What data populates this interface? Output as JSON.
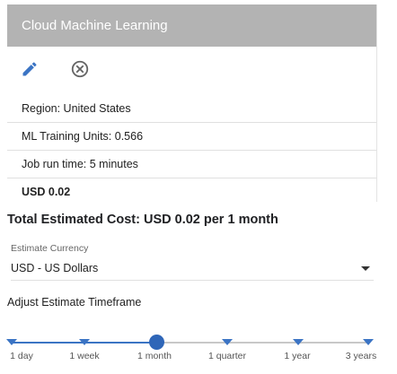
{
  "card": {
    "title": "Cloud Machine Learning",
    "edit_icon": "pencil-icon",
    "remove_icon": "close-circle-icon",
    "rows": [
      "Region: United States",
      "ML Training Units: 0.566",
      "Job run time: 5 minutes",
      "USD 0.02"
    ]
  },
  "total": {
    "text": "Total Estimated Cost: USD 0.02 per 1 month"
  },
  "currency": {
    "label": "Estimate Currency",
    "selected": "USD - US Dollars"
  },
  "timeframe": {
    "title": "Adjust Estimate Timeframe",
    "options": [
      "1 day",
      "1 week",
      "1 month",
      "1 quarter",
      "1 year",
      "3 years"
    ],
    "selected": "1 month"
  },
  "colors": {
    "header_bg": "#b3b3b3",
    "accent": "#3b74c4",
    "track_inactive": "#c8c8c8"
  }
}
